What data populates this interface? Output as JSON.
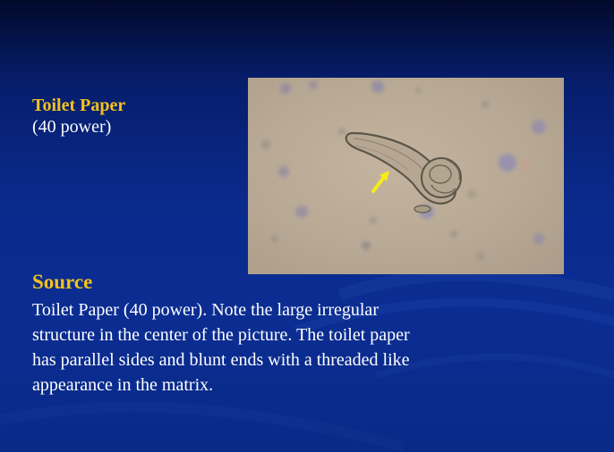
{
  "slide": {
    "title": "Toilet Paper",
    "subtitle": "(40 power)",
    "source_heading": "Source",
    "body": "Toilet Paper (40 power). Note the large irregular\nstructure in the center of the picture.  The toilet paper\nhas parallel sides and blunt ends with a threaded like\nappearance in the matrix."
  },
  "image": {
    "subject": "micrograph of toilet paper fiber",
    "arrow_color": "#f5ec1a"
  },
  "colors": {
    "title": "#f2c21a",
    "text": "#ffffff",
    "background": "#0a2a8c"
  }
}
